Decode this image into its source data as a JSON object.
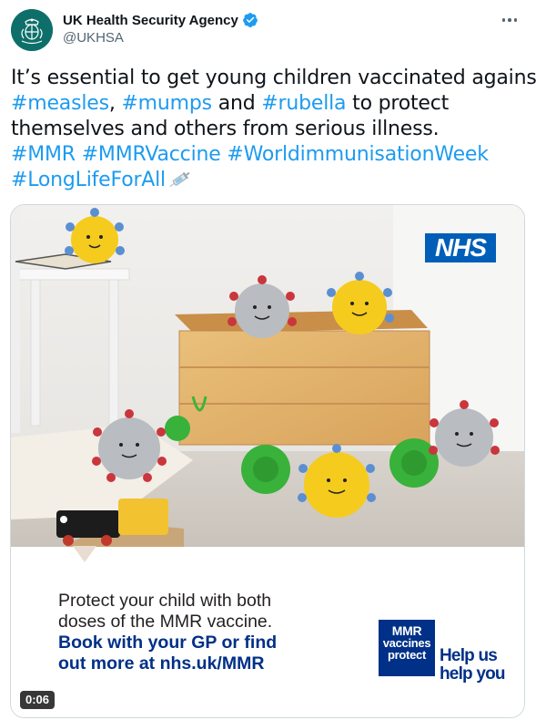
{
  "author": {
    "display_name": "UK Health Security Agency",
    "handle": "@UKHSA",
    "verified": true,
    "avatar_icon": "ukhsa-crest-icon",
    "avatar_color": "#0e6f6a"
  },
  "more_icon": "more-horizontal-icon",
  "tweet": {
    "line1": "It’s essential to get young children vaccinated against",
    "hashtag_measles": "#measles",
    "comma": ",",
    "hashtag_mumps": "#mumps",
    "and": "and",
    "hashtag_rubella": "#rubella",
    "to_protect": "to protect",
    "line3": "themselves and others from serious illness.",
    "hashtag_mmr": "#MMR",
    "hashtag_mmrvaccine": "#MMRVaccine",
    "hashtag_wiw": "#WorldimmunisationWeek",
    "hashtag_longlife": "#LongLifeForAll",
    "emoji": "syringe-icon",
    "link_color": "#1d9bf0"
  },
  "media": {
    "nhs_logo": "NHS",
    "caption_line1": "Protect your child with both",
    "caption_line2": "doses of the MMR vaccine.",
    "caption_line3": "Book with your GP or find",
    "caption_line4": "out more at nhs.uk/MMR",
    "badge_line1": "MMR",
    "badge_line2": "vaccines",
    "badge_line3": "protect",
    "help_line1": "Help us",
    "help_line2": "help you",
    "duration": "0:06",
    "nhs_blue": "#005eb8",
    "nhs_dark_blue": "#003087"
  }
}
